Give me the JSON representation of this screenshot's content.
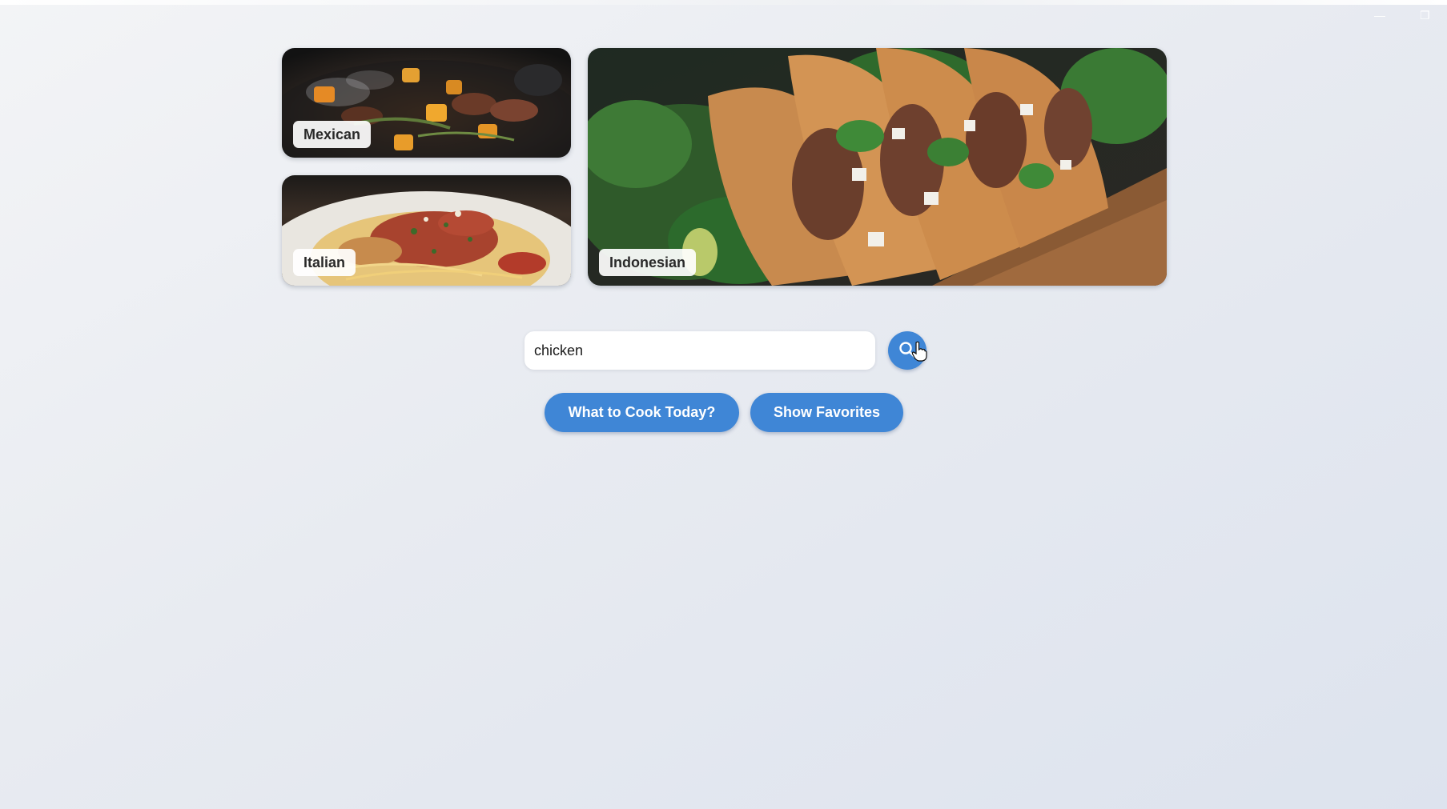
{
  "window": {
    "minimize_glyph": "—",
    "restore_glyph": "❐"
  },
  "categories": [
    {
      "label": "Mexican",
      "image": "food-photo-stir-fry"
    },
    {
      "label": "Italian",
      "image": "food-photo-spaghetti"
    },
    {
      "label": "Indonesian",
      "image": "food-photo-tacos"
    }
  ],
  "search": {
    "value": "chicken",
    "placeholder": "",
    "button_icon": "search-icon"
  },
  "actions": {
    "cook_today_label": "What to Cook Today?",
    "show_favorites_label": "Show Favorites"
  },
  "colors": {
    "accent": "#3f86d6",
    "label_bg": "#ffffff",
    "label_text": "#2a2a2a"
  }
}
